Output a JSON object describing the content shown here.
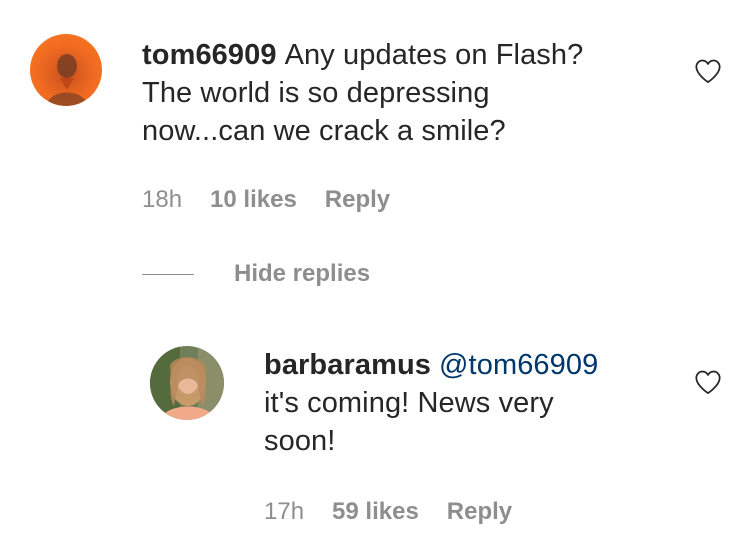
{
  "comments": [
    {
      "username": "tom66909",
      "text": "Any updates on Flash? The world is so depressing now...can we crack a smile?",
      "line1": "Any updates on Flash?",
      "line2": "The world is so depressing",
      "line3": "now...can we crack a smile?",
      "time": "18h",
      "likes": "10 likes",
      "reply_label": "Reply"
    }
  ],
  "replies_toggle": {
    "label": "Hide replies"
  },
  "replies": [
    {
      "username": "barbaramus",
      "mention": "@tom66909",
      "line2": "it's coming! News very",
      "line3": "soon!",
      "time": "17h",
      "likes": "59 likes",
      "reply_label": "Reply"
    }
  ],
  "icons": {
    "like": "heart-outline-icon"
  },
  "colors": {
    "text": "#262626",
    "secondary": "#8e8e8e",
    "mention": "#00376b",
    "avatar_orange": "#f2611d"
  }
}
